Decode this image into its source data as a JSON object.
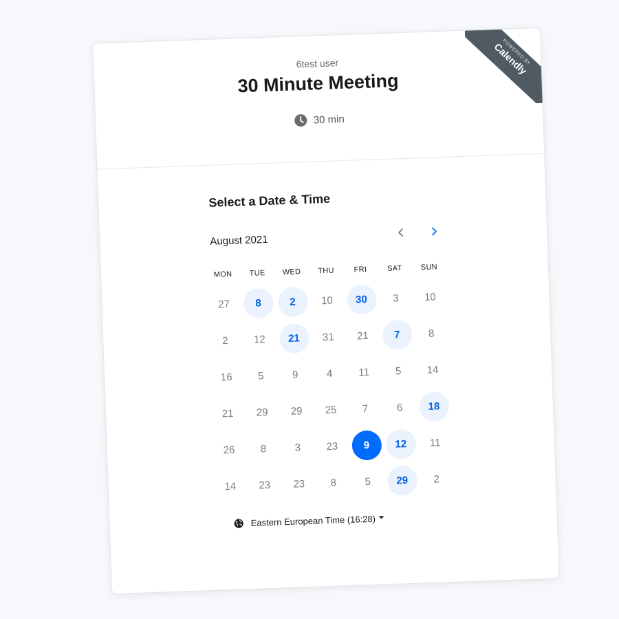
{
  "header": {
    "owner_name": "6test user",
    "event_title": "30 Minute Meeting",
    "duration": "30 min"
  },
  "branding": {
    "powered_by": "POWERED BY",
    "brand": "Calendly"
  },
  "scheduler": {
    "section_title": "Select a Date & Time",
    "month_label": "August 2021",
    "weekdays": [
      "MON",
      "TUE",
      "WED",
      "THU",
      "FRI",
      "SAT",
      "SUN"
    ],
    "weeks": [
      [
        {
          "d": "27",
          "s": "none"
        },
        {
          "d": "8",
          "s": "avail"
        },
        {
          "d": "2",
          "s": "avail"
        },
        {
          "d": "10",
          "s": "none"
        },
        {
          "d": "30",
          "s": "avail"
        },
        {
          "d": "3",
          "s": "none"
        },
        {
          "d": "10",
          "s": "none"
        }
      ],
      [
        {
          "d": "2",
          "s": "none"
        },
        {
          "d": "12",
          "s": "none"
        },
        {
          "d": "21",
          "s": "avail"
        },
        {
          "d": "31",
          "s": "none"
        },
        {
          "d": "21",
          "s": "none"
        },
        {
          "d": "7",
          "s": "avail"
        },
        {
          "d": "8",
          "s": "none"
        }
      ],
      [
        {
          "d": "16",
          "s": "none"
        },
        {
          "d": "5",
          "s": "none"
        },
        {
          "d": "9",
          "s": "none"
        },
        {
          "d": "4",
          "s": "none"
        },
        {
          "d": "11",
          "s": "none"
        },
        {
          "d": "5",
          "s": "none"
        },
        {
          "d": "14",
          "s": "none"
        }
      ],
      [
        {
          "d": "21",
          "s": "none"
        },
        {
          "d": "29",
          "s": "none"
        },
        {
          "d": "29",
          "s": "none"
        },
        {
          "d": "25",
          "s": "none"
        },
        {
          "d": "7",
          "s": "none"
        },
        {
          "d": "6",
          "s": "none"
        },
        {
          "d": "18",
          "s": "avail"
        }
      ],
      [
        {
          "d": "26",
          "s": "none"
        },
        {
          "d": "8",
          "s": "none"
        },
        {
          "d": "3",
          "s": "none"
        },
        {
          "d": "23",
          "s": "none"
        },
        {
          "d": "9",
          "s": "selected"
        },
        {
          "d": "12",
          "s": "avail"
        },
        {
          "d": "11",
          "s": "none"
        }
      ],
      [
        {
          "d": "14",
          "s": "none"
        },
        {
          "d": "23",
          "s": "none"
        },
        {
          "d": "23",
          "s": "none"
        },
        {
          "d": "8",
          "s": "none"
        },
        {
          "d": "5",
          "s": "none"
        },
        {
          "d": "29",
          "s": "avail"
        },
        {
          "d": "2",
          "s": "none"
        }
      ]
    ],
    "timezone_label": "Eastern European Time (16:28)"
  },
  "icons": {
    "clock": "clock-icon",
    "prev": "chevron-left-icon",
    "next": "chevron-right-icon",
    "globe": "globe-icon",
    "caret": "caret-down-icon"
  },
  "colors": {
    "accent": "#006bff",
    "available_bg": "#eaf2fe",
    "available_text": "#0060e6",
    "ribbon": "#4f5a63"
  }
}
